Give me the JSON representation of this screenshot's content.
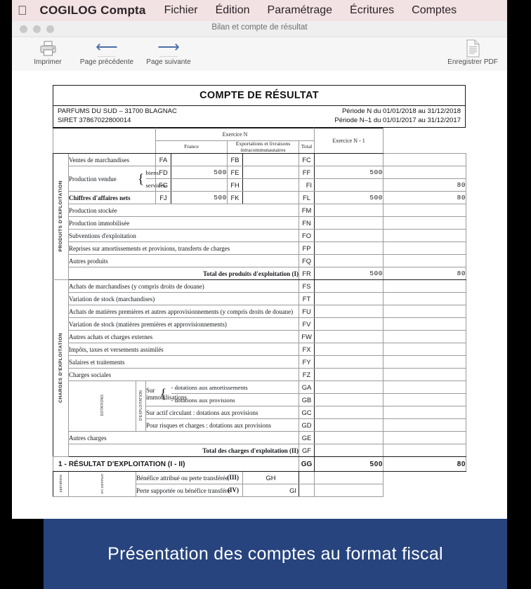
{
  "menubar": {
    "apple_icon": "apple-icon",
    "app_name": "COGILOG Compta",
    "items": [
      "Fichier",
      "Édition",
      "Paramétrage",
      "Écritures",
      "Comptes"
    ]
  },
  "window": {
    "title": "Bilan et compte de résultat",
    "toolbar": {
      "print_label": "Imprimer",
      "prev_label": "Page précédente",
      "next_label": "Page suivante",
      "pdf_label": "Enregistrer PDF"
    }
  },
  "document": {
    "title": "COMPTE DE RÉSULTAT",
    "company": "PARFUMS DU SUD – 31700 BLAGNAC",
    "siret": "SIRET 37867022800014",
    "period_n": "Période N du 01/01/2018 au 31/12/2018",
    "period_n1": "Période N–1 du 01/01/2017 au 31/12/2017",
    "headers": {
      "exercice_n": "Exercice N",
      "exercice_n1": "Exercice N - 1",
      "france": "France",
      "exportations": "Exportations et livraisons intracommunautaires",
      "total": "Total"
    },
    "side_labels": {
      "produits": "PRODUITS D'EXPLOITATION",
      "charges": "CHARGES D'EXPLOITATION",
      "dotations": "DOTATIONS",
      "dexploitation": "D'EXPLOITATION",
      "operations": "opérations",
      "en_commun": "en commun"
    },
    "rows": {
      "ventes": {
        "label": "Ventes de marchandises",
        "c1": "FA",
        "v1": "",
        "c2": "FB",
        "v2": "",
        "c3": "FC",
        "v3": "",
        "v4": ""
      },
      "prod_biens": {
        "label": "Production vendue",
        "brace_top": "biens",
        "brace_bot": "services",
        "c1": "FD",
        "v1": "500",
        "c2": "FE",
        "v2": "",
        "c3": "FF",
        "v3": "500",
        "v4": ""
      },
      "prod_services": {
        "c1": "FG",
        "v1": "",
        "c2": "FH",
        "v2": "",
        "c3": "FI",
        "v3": "",
        "v4": "80"
      },
      "ca_nets": {
        "label": "Chiffres d'affaires nets",
        "c1": "FJ",
        "v1": "500",
        "c2": "FK",
        "v2": "",
        "c3": "FL",
        "v3": "500",
        "v4": "80"
      },
      "prod_stockee": {
        "label": "Production stockée",
        "code": "FM",
        "v3": "",
        "v4": ""
      },
      "prod_immo": {
        "label": "Production immobilisée",
        "code": "FN",
        "v3": "",
        "v4": ""
      },
      "subventions": {
        "label": "Subventions d'exploitation",
        "code": "FO",
        "v3": "",
        "v4": ""
      },
      "reprises": {
        "label": "Reprises sur amortissements et provisions, transferts de charges",
        "code": "FP",
        "v3": "",
        "v4": ""
      },
      "autres_produits": {
        "label": "Autres produits",
        "code": "FQ",
        "v3": "",
        "v4": ""
      },
      "total_produits": {
        "label": "Total des produits d'exploitation (I)",
        "code": "FR",
        "v3": "500",
        "v4": "80"
      },
      "achats_march": {
        "label": "Achats de marchandises (y compris droits de douane)",
        "code": "FS",
        "v3": "",
        "v4": ""
      },
      "var_stock_march": {
        "label": "Variation de stock (marchandises)",
        "code": "FT",
        "v3": "",
        "v4": ""
      },
      "achats_mp": {
        "label": "Achats de matières premières et autres approvisionnements (y compris droits de douane)",
        "code": "FU",
        "v3": "",
        "v4": ""
      },
      "var_stock_mp": {
        "label": "Variation de stock (matières premières et approvisionnements)",
        "code": "FV",
        "v3": "",
        "v4": ""
      },
      "autres_achats": {
        "label": "Autres achats et charges externes",
        "code": "FW",
        "v3": "",
        "v4": ""
      },
      "impots": {
        "label": "Impôts, taxes et versements assimilés",
        "code": "FX",
        "v3": "",
        "v4": ""
      },
      "salaires": {
        "label": "Salaires et traitements",
        "code": "FY",
        "v3": "",
        "v4": ""
      },
      "charges_soc": {
        "label": "Charges sociales",
        "code": "FZ",
        "v3": "",
        "v4": ""
      },
      "sur_immo_amort": {
        "label": "Sur immobilisations",
        "sub": "- dotations aux amortissements",
        "code": "GA",
        "v3": "",
        "v4": ""
      },
      "sur_immo_prov": {
        "sub": "- dotations aux provisions",
        "code": "GB",
        "v3": "",
        "v4": ""
      },
      "actif_circ": {
        "label": "Sur actif circulant : dotations aux provisions",
        "code": "GC",
        "v3": "",
        "v4": ""
      },
      "risques": {
        "label": "Pour risques et charges : dotations aux provisions",
        "code": "GD",
        "v3": "",
        "v4": ""
      },
      "autres_charges": {
        "label": "Autres charges",
        "code": "GE",
        "v3": "",
        "v4": ""
      },
      "total_charges": {
        "label": "Total des charges d'exploitation (II)",
        "code": "GF",
        "v3": "",
        "v4": ""
      },
      "resultat": {
        "label": "1 - RÉSULTAT D'EXPLOITATION (I - II)",
        "code": "GG",
        "v3": "500",
        "v4": "80"
      },
      "benefice": {
        "label": "Bénéfice attribué ou perte transférée",
        "roman": "(III)",
        "code": "GH",
        "v3": "",
        "v4": ""
      },
      "perte": {
        "label": "Perte supportée ou bénéfice transféré",
        "roman": "(IV)",
        "code": "GI",
        "v3": "",
        "v4": ""
      }
    }
  },
  "banner": {
    "caption": "Présentation des comptes au format fiscal",
    "color": "#27447e"
  }
}
